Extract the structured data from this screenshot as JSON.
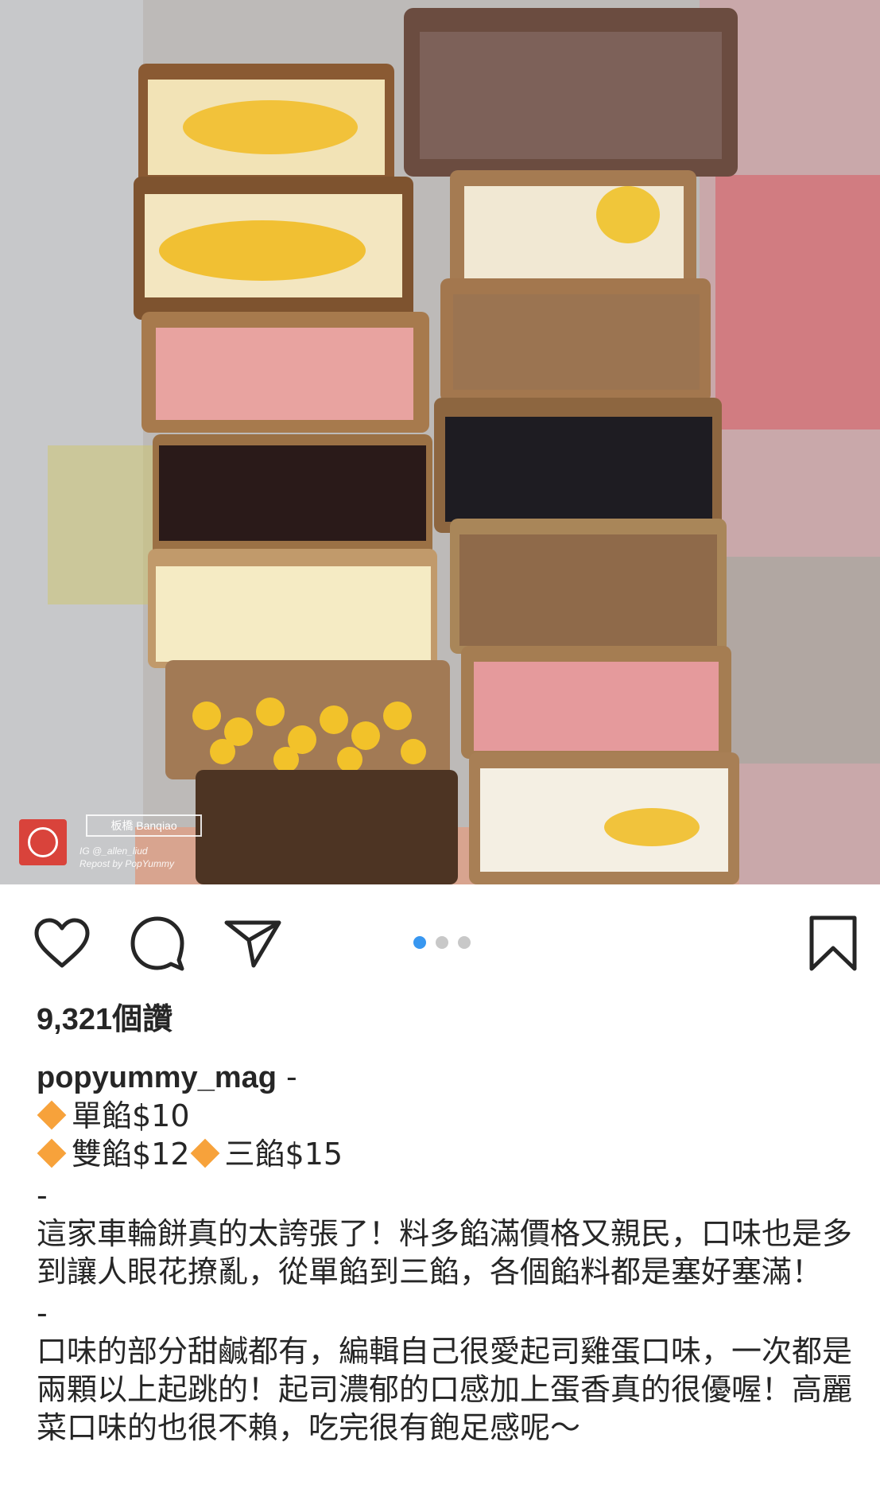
{
  "photo": {
    "location_tag": "板橋 Banqiao",
    "credit_line1": "IG @_allen_liud",
    "credit_line2": "Repost by PopYummy"
  },
  "actions": {
    "like_icon": "heart-icon",
    "comment_icon": "comment-icon",
    "share_icon": "share-icon",
    "save_icon": "bookmark-icon",
    "carousel": {
      "count": 3,
      "active_index": 0,
      "active_color": "#3897f0",
      "inactive_color": "#c8c8c8"
    }
  },
  "likes": "9,321個讚",
  "caption": {
    "username": "popyummy_mag",
    "after_username": " -",
    "price_line1_a": "單餡$10",
    "price_line2_a": "雙餡$12",
    "price_line2_b": "三餡$15",
    "separator1": "-",
    "paragraph1": "這家車輪餅真的太誇張了！料多餡滿價格又親民，口味也是多到讓人眼花撩亂，從單餡到三餡，各個餡料都是塞好塞滿！",
    "separator2": "-",
    "paragraph2": "口味的部分甜鹹都有，編輯自己很愛起司雞蛋口味，一次都是兩顆以上起跳的！起司濃郁的口感加上蛋香真的很優喔！高麗菜口味的也很不賴，吃完很有飽足感呢～"
  },
  "colors": {
    "diamond": "#f7a23b",
    "text": "#262626"
  }
}
